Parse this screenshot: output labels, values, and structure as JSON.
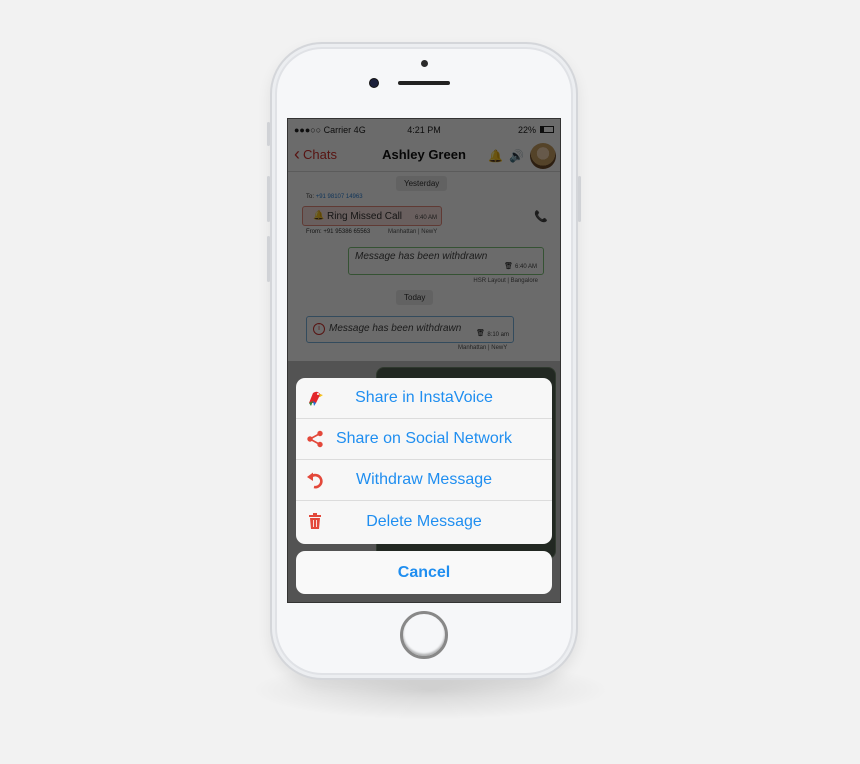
{
  "status_bar": {
    "carrier": "●●●○○ Carrier 4G",
    "time": "4:21 PM",
    "battery": "22%",
    "battery_level": 0.22
  },
  "nav": {
    "back_label": "Chats",
    "title": "Ashley Green",
    "icons": [
      "ring-bell-icon",
      "speaker-icon",
      "avatar"
    ]
  },
  "chat": {
    "date_yesterday": "Yesterday",
    "date_today": "Today",
    "missed_call": {
      "to_label": "To:",
      "to_number": "+91 98107 14963",
      "text": "Ring Missed Call",
      "time": "6:40 AM",
      "from_label": "From:",
      "from_number": "+91 95386 65563",
      "location": "Manhattan | NewY"
    },
    "sent_withdrawn": {
      "text": "Message has been withdrawn",
      "time": "6:40 AM",
      "location": "HSR Layout | Bangalore"
    },
    "recv_withdrawn": {
      "text": "Message has been withdrawn",
      "time": "8:10 am",
      "location": "Manhattan | NewY"
    }
  },
  "action_sheet": {
    "items": [
      {
        "label": "Share in InstaVoice",
        "icon": "instavoice-parrot-icon"
      },
      {
        "label": "Share on Social Network",
        "icon": "share-icon"
      },
      {
        "label": "Withdraw Message",
        "icon": "undo-icon"
      },
      {
        "label": "Delete Message",
        "icon": "trash-icon"
      }
    ],
    "cancel_label": "Cancel"
  },
  "colors": {
    "accent_blue": "#1f8ef0",
    "brand_red": "#d0312d",
    "sent_border": "#7fc47a",
    "recv_border": "#7ab4de"
  }
}
